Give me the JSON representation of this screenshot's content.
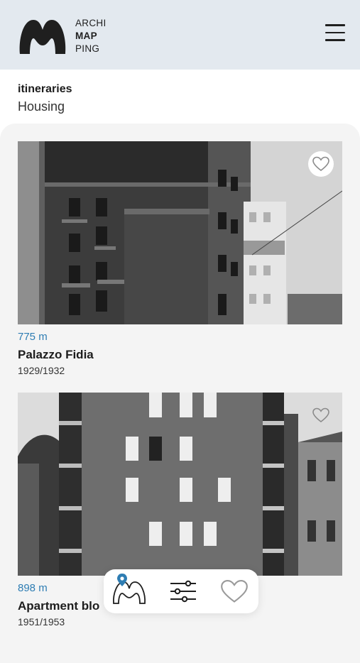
{
  "header": {
    "logo_lines": [
      "ARCHI",
      "MAP",
      "PING"
    ],
    "menu_icon": "hamburger-menu-icon"
  },
  "context": {
    "label": "itineraries",
    "value": "Housing"
  },
  "cards": [
    {
      "distance": "775 m",
      "title": "Palazzo Fidia",
      "years": "1929/1932",
      "favorite_icon": "heart-outline-icon",
      "photo": "black-and-white-building-photo"
    },
    {
      "distance": "898 m",
      "title": "Apartment blo",
      "years": "1951/1953",
      "favorite_icon": "heart-outline-icon",
      "photo": "black-and-white-building-photo"
    }
  ],
  "bottom_nav": {
    "items": [
      {
        "icon": "map-logo-pin-icon",
        "active": true
      },
      {
        "icon": "filter-sliders-icon",
        "active": false
      },
      {
        "icon": "heart-outline-icon",
        "active": false
      }
    ]
  },
  "colors": {
    "header_bg": "#e3e9ef",
    "accent": "#2e7db3",
    "panel_bg": "#f4f4f4"
  }
}
